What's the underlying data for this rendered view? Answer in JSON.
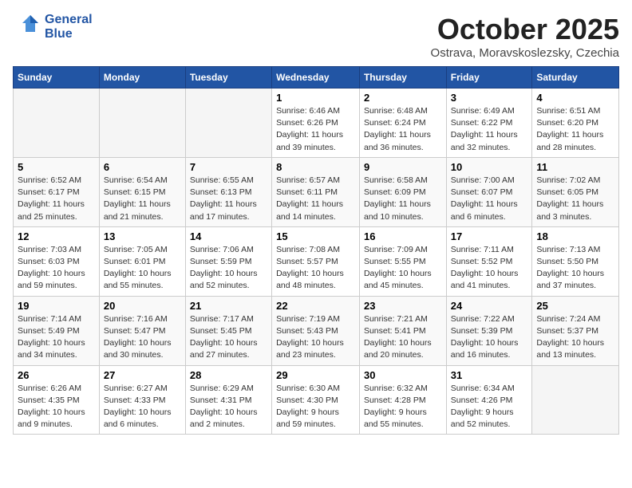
{
  "logo": {
    "line1": "General",
    "line2": "Blue"
  },
  "title": "October 2025",
  "subtitle": "Ostrava, Moravskoslezsky, Czechia",
  "headers": [
    "Sunday",
    "Monday",
    "Tuesday",
    "Wednesday",
    "Thursday",
    "Friday",
    "Saturday"
  ],
  "weeks": [
    [
      {
        "day": "",
        "info": ""
      },
      {
        "day": "",
        "info": ""
      },
      {
        "day": "",
        "info": ""
      },
      {
        "day": "1",
        "info": "Sunrise: 6:46 AM\nSunset: 6:26 PM\nDaylight: 11 hours\nand 39 minutes."
      },
      {
        "day": "2",
        "info": "Sunrise: 6:48 AM\nSunset: 6:24 PM\nDaylight: 11 hours\nand 36 minutes."
      },
      {
        "day": "3",
        "info": "Sunrise: 6:49 AM\nSunset: 6:22 PM\nDaylight: 11 hours\nand 32 minutes."
      },
      {
        "day": "4",
        "info": "Sunrise: 6:51 AM\nSunset: 6:20 PM\nDaylight: 11 hours\nand 28 minutes."
      }
    ],
    [
      {
        "day": "5",
        "info": "Sunrise: 6:52 AM\nSunset: 6:17 PM\nDaylight: 11 hours\nand 25 minutes."
      },
      {
        "day": "6",
        "info": "Sunrise: 6:54 AM\nSunset: 6:15 PM\nDaylight: 11 hours\nand 21 minutes."
      },
      {
        "day": "7",
        "info": "Sunrise: 6:55 AM\nSunset: 6:13 PM\nDaylight: 11 hours\nand 17 minutes."
      },
      {
        "day": "8",
        "info": "Sunrise: 6:57 AM\nSunset: 6:11 PM\nDaylight: 11 hours\nand 14 minutes."
      },
      {
        "day": "9",
        "info": "Sunrise: 6:58 AM\nSunset: 6:09 PM\nDaylight: 11 hours\nand 10 minutes."
      },
      {
        "day": "10",
        "info": "Sunrise: 7:00 AM\nSunset: 6:07 PM\nDaylight: 11 hours\nand 6 minutes."
      },
      {
        "day": "11",
        "info": "Sunrise: 7:02 AM\nSunset: 6:05 PM\nDaylight: 11 hours\nand 3 minutes."
      }
    ],
    [
      {
        "day": "12",
        "info": "Sunrise: 7:03 AM\nSunset: 6:03 PM\nDaylight: 10 hours\nand 59 minutes."
      },
      {
        "day": "13",
        "info": "Sunrise: 7:05 AM\nSunset: 6:01 PM\nDaylight: 10 hours\nand 55 minutes."
      },
      {
        "day": "14",
        "info": "Sunrise: 7:06 AM\nSunset: 5:59 PM\nDaylight: 10 hours\nand 52 minutes."
      },
      {
        "day": "15",
        "info": "Sunrise: 7:08 AM\nSunset: 5:57 PM\nDaylight: 10 hours\nand 48 minutes."
      },
      {
        "day": "16",
        "info": "Sunrise: 7:09 AM\nSunset: 5:55 PM\nDaylight: 10 hours\nand 45 minutes."
      },
      {
        "day": "17",
        "info": "Sunrise: 7:11 AM\nSunset: 5:52 PM\nDaylight: 10 hours\nand 41 minutes."
      },
      {
        "day": "18",
        "info": "Sunrise: 7:13 AM\nSunset: 5:50 PM\nDaylight: 10 hours\nand 37 minutes."
      }
    ],
    [
      {
        "day": "19",
        "info": "Sunrise: 7:14 AM\nSunset: 5:49 PM\nDaylight: 10 hours\nand 34 minutes."
      },
      {
        "day": "20",
        "info": "Sunrise: 7:16 AM\nSunset: 5:47 PM\nDaylight: 10 hours\nand 30 minutes."
      },
      {
        "day": "21",
        "info": "Sunrise: 7:17 AM\nSunset: 5:45 PM\nDaylight: 10 hours\nand 27 minutes."
      },
      {
        "day": "22",
        "info": "Sunrise: 7:19 AM\nSunset: 5:43 PM\nDaylight: 10 hours\nand 23 minutes."
      },
      {
        "day": "23",
        "info": "Sunrise: 7:21 AM\nSunset: 5:41 PM\nDaylight: 10 hours\nand 20 minutes."
      },
      {
        "day": "24",
        "info": "Sunrise: 7:22 AM\nSunset: 5:39 PM\nDaylight: 10 hours\nand 16 minutes."
      },
      {
        "day": "25",
        "info": "Sunrise: 7:24 AM\nSunset: 5:37 PM\nDaylight: 10 hours\nand 13 minutes."
      }
    ],
    [
      {
        "day": "26",
        "info": "Sunrise: 6:26 AM\nSunset: 4:35 PM\nDaylight: 10 hours\nand 9 minutes."
      },
      {
        "day": "27",
        "info": "Sunrise: 6:27 AM\nSunset: 4:33 PM\nDaylight: 10 hours\nand 6 minutes."
      },
      {
        "day": "28",
        "info": "Sunrise: 6:29 AM\nSunset: 4:31 PM\nDaylight: 10 hours\nand 2 minutes."
      },
      {
        "day": "29",
        "info": "Sunrise: 6:30 AM\nSunset: 4:30 PM\nDaylight: 9 hours\nand 59 minutes."
      },
      {
        "day": "30",
        "info": "Sunrise: 6:32 AM\nSunset: 4:28 PM\nDaylight: 9 hours\nand 55 minutes."
      },
      {
        "day": "31",
        "info": "Sunrise: 6:34 AM\nSunset: 4:26 PM\nDaylight: 9 hours\nand 52 minutes."
      },
      {
        "day": "",
        "info": ""
      }
    ]
  ]
}
